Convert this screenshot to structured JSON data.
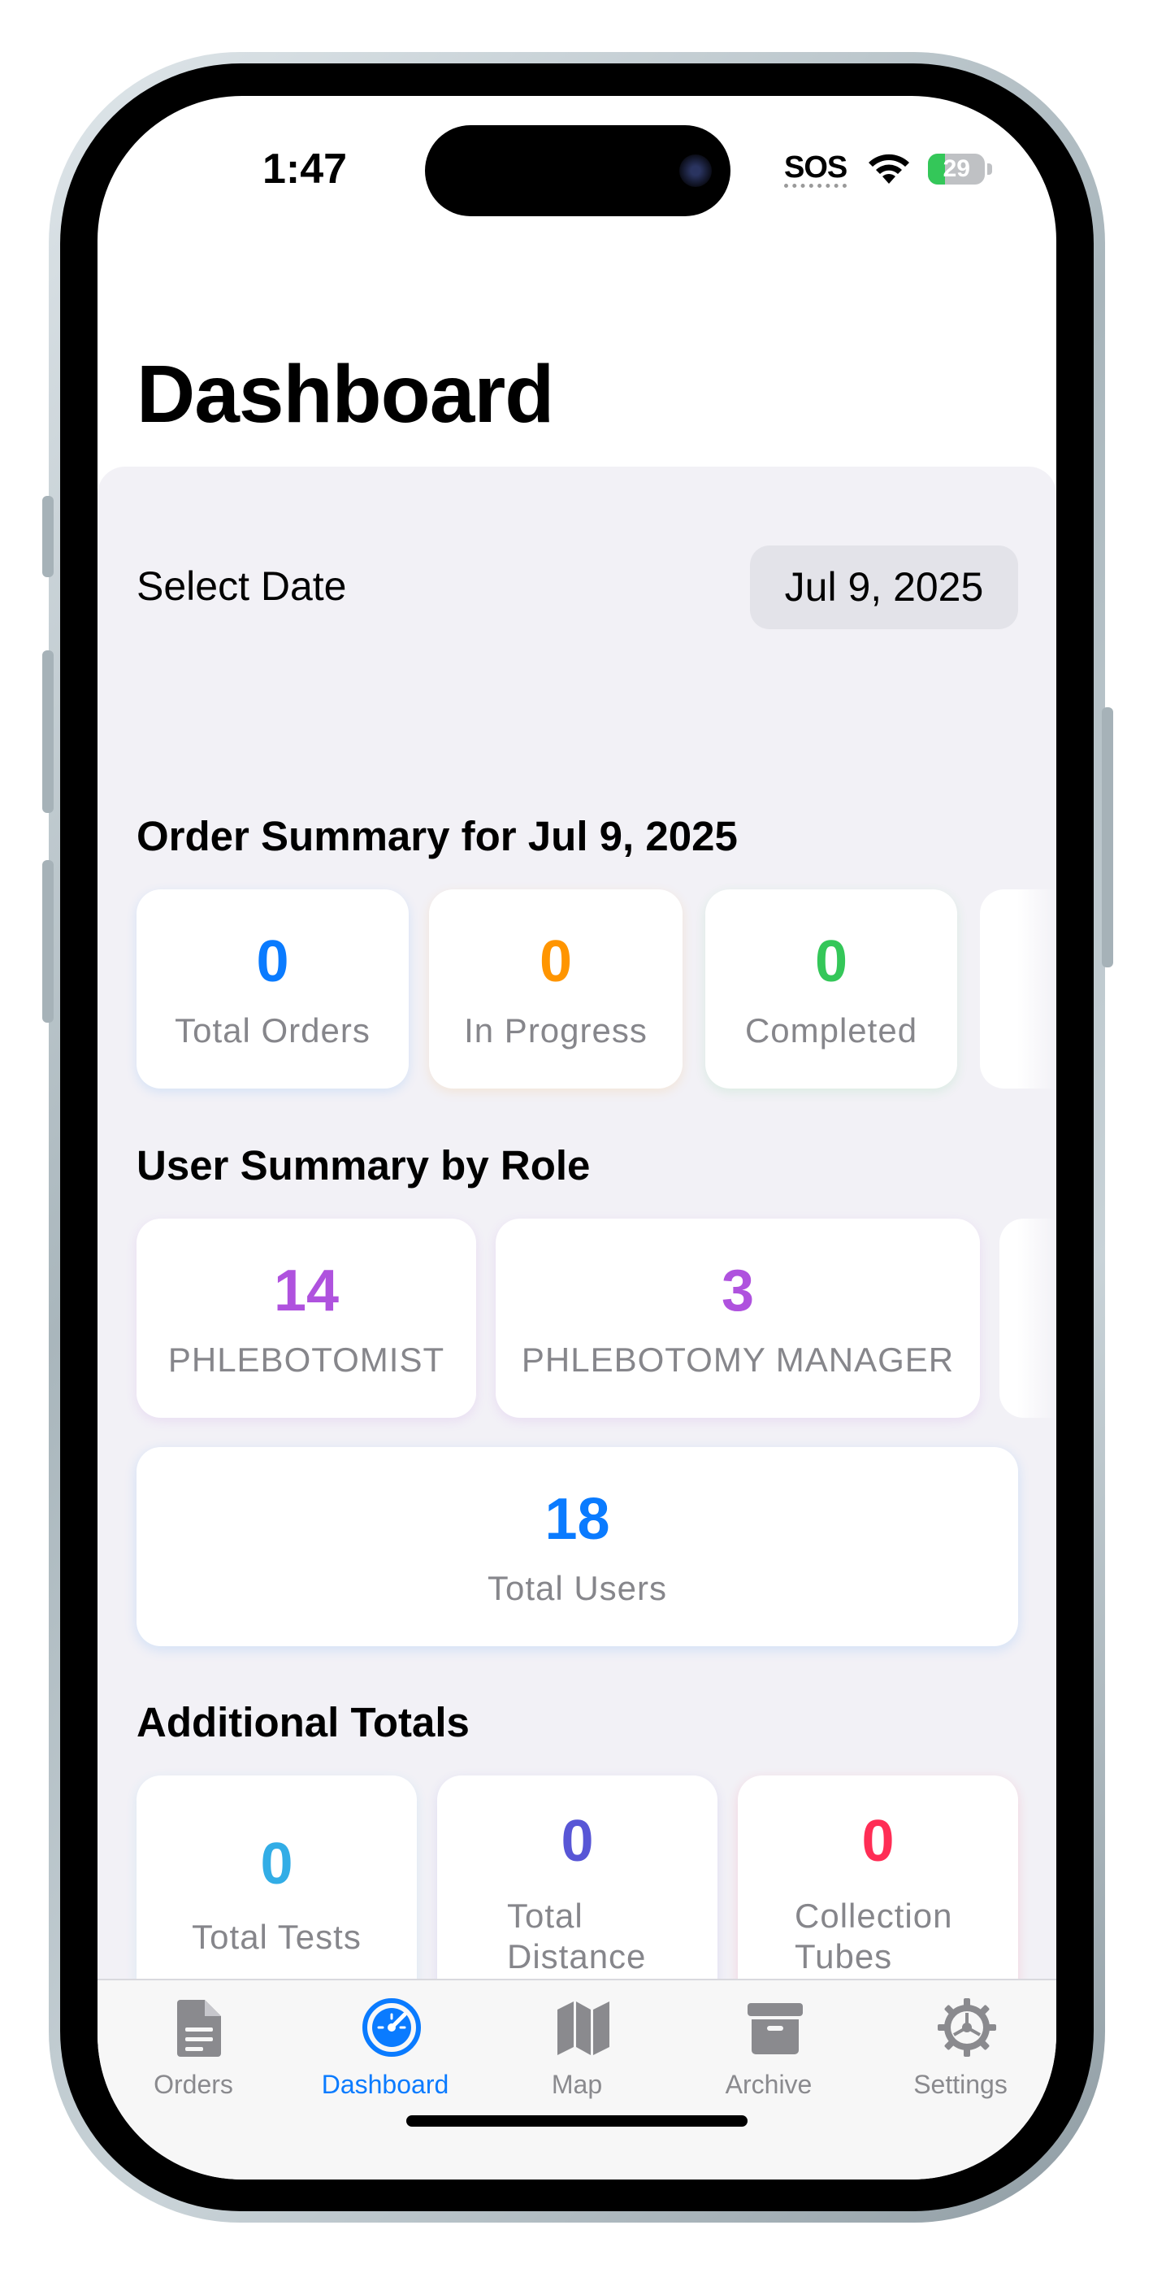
{
  "status_bar": {
    "time": "1:47",
    "sos": "SOS",
    "battery": "29"
  },
  "page": {
    "title": "Dashboard"
  },
  "date_selector": {
    "label": "Select Date",
    "value": "Jul 9, 2025"
  },
  "order_summary": {
    "title": "Order Summary for Jul 9, 2025",
    "cards": [
      {
        "value": "0",
        "label": "Total Orders",
        "color": "#0a7bff"
      },
      {
        "value": "0",
        "label": "In Progress",
        "color": "#ff9500"
      },
      {
        "value": "0",
        "label": "Completed",
        "color": "#34c759"
      }
    ]
  },
  "user_summary": {
    "title": "User Summary by Role",
    "cards": [
      {
        "value": "14",
        "label": "PHLEBOTOMIST",
        "color": "#af52de"
      },
      {
        "value": "3",
        "label": "PHLEBOTOMY MANAGER",
        "color": "#af52de"
      }
    ],
    "total": {
      "value": "18",
      "label": "Total Users",
      "color": "#0a7bff"
    }
  },
  "additional_totals": {
    "title": "Additional Totals",
    "cards": [
      {
        "value": "0",
        "label": "Total Tests",
        "color": "#32ade6"
      },
      {
        "value": "0",
        "label": "Total Distance",
        "color": "#5856d6"
      },
      {
        "value": "0",
        "label": "Collection Tubes",
        "color": "#ff2d55"
      }
    ]
  },
  "tab_bar": {
    "items": [
      {
        "label": "Orders",
        "icon": "document-icon",
        "active": false
      },
      {
        "label": "Dashboard",
        "icon": "speedometer-icon",
        "active": true
      },
      {
        "label": "Map",
        "icon": "map-icon",
        "active": false
      },
      {
        "label": "Archive",
        "icon": "archive-box-icon",
        "active": false
      },
      {
        "label": "Settings",
        "icon": "gear-icon",
        "active": false
      }
    ]
  },
  "colors": {
    "accent": "#0a7bff",
    "background": "#f2f1f6",
    "card": "#ffffff",
    "tab_inactive": "#8a8a8e"
  }
}
